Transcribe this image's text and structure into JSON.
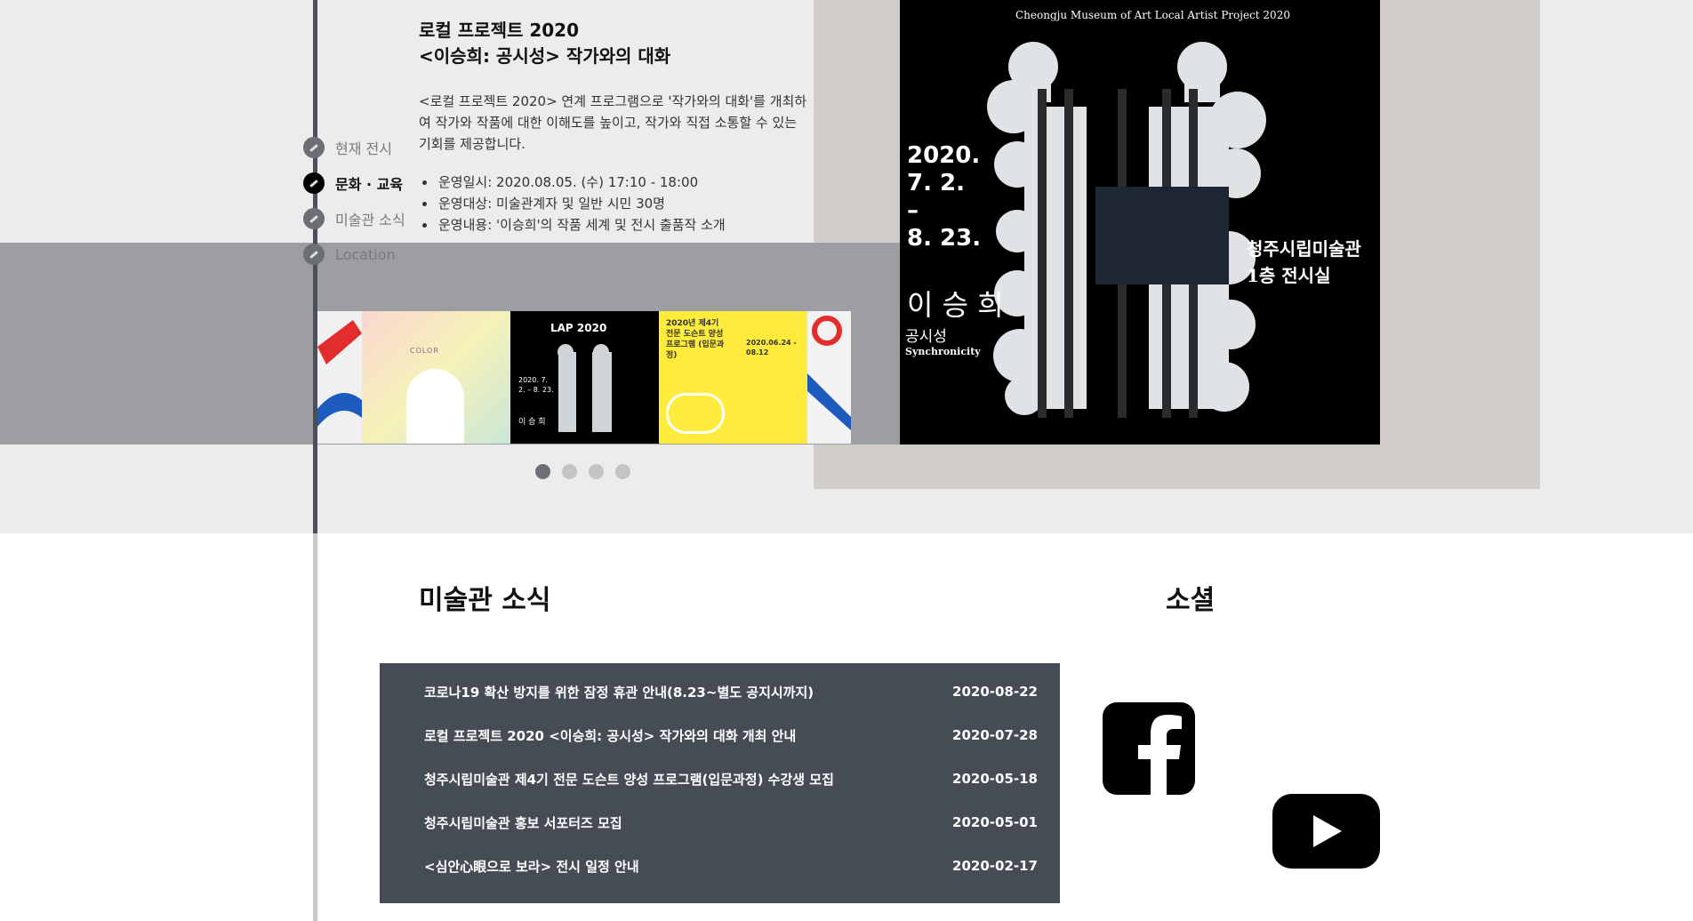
{
  "nav": {
    "items": [
      {
        "label": "현재 전시",
        "active": false
      },
      {
        "label": "문화 · 교육",
        "active": true
      },
      {
        "label": "미술관 소식",
        "active": false
      },
      {
        "label": "Location",
        "active": false
      }
    ]
  },
  "program": {
    "title_line1": "로컬 프로젝트 2020",
    "title_line2": "<이승희: 공시성> 작가와의 대화",
    "description": "<로컬 프로젝트 2020> 연계 프로그램으로 '작가와의 대화'를 개최하여 작가와 작품에 대한 이해도를 높이고, 작가와 직접 소통할 수 있는 기회를 제공합니다.",
    "bullets": [
      "운영일시: 2020.08.05. (수) 17:10 - 18:00",
      "운영대상: 미술관계자 및 일반 시민 30명",
      "운영내용: '이승희'의 작품 세계 및 전시 출품작 소개"
    ]
  },
  "poster": {
    "subtitle": "Cheongju Museum of Art Local Artist Project 2020",
    "date_line1": "2020.",
    "date_line2": "7. 2.",
    "date_dash": "–",
    "date_line3": "8. 23.",
    "artist": "이 승 희",
    "work_ko": "공시성",
    "work_en": "Synchronicity",
    "venue_line1": "청주시립미술관",
    "venue_line2": "1층 전시실"
  },
  "thumbnails": {
    "thumb1_text": "COLOR",
    "thumb2_title": "LAP 2020",
    "thumb2_date": "2020. 7. 2. – 8. 23.",
    "thumb2_artist": "이 승 희",
    "thumb3_title": "2020년 제4기 전문 도슨트 양성 프로그램 (입문과정)",
    "thumb3_date": "2020.06.24 - 08.12"
  },
  "slider": {
    "count": 4,
    "active_index": 0
  },
  "news": {
    "heading": "미술관 소식",
    "items": [
      {
        "title": "코로나19 확산 방지를 위한 잠정 휴관 안내(8.23~별도 공지시까지)",
        "date": "2020-08-22"
      },
      {
        "title": "로컬 프로젝트 2020 <이승희: 공시성> 작가와의 대화 개최 안내",
        "date": "2020-07-28"
      },
      {
        "title": "청주시립미술관 제4기 전문 도슨트 양성 프로그램(입문과정) 수강생 모집",
        "date": "2020-05-18"
      },
      {
        "title": "청주시립미술관 홍보 서포터즈 모집",
        "date": "2020-05-01"
      },
      {
        "title": "<심안心眼으로 보라> 전시 일정 안내",
        "date": "2020-02-17"
      }
    ]
  },
  "social": {
    "heading": "소셜",
    "links": [
      {
        "name": "facebook-icon"
      },
      {
        "name": "youtube-icon"
      }
    ]
  },
  "colors": {
    "news_panel": "#464c56",
    "band_gray": "#9d9ea2",
    "page_gray": "#ececec"
  }
}
